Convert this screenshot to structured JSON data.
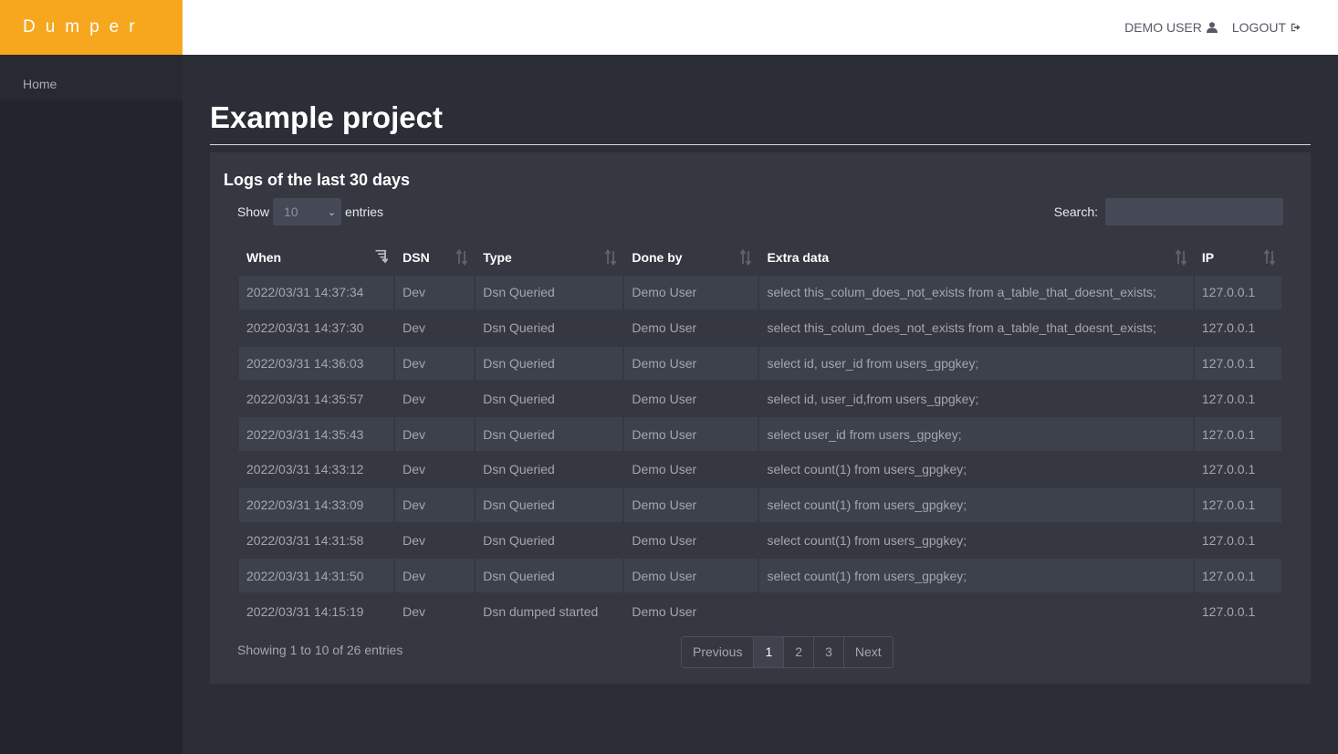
{
  "brand": "Dumper",
  "topnav": {
    "user": "DEMO USER",
    "logout": "LOGOUT"
  },
  "sidebar": {
    "items": [
      {
        "label": "Home"
      }
    ]
  },
  "page": {
    "title": "Example project"
  },
  "card": {
    "title": "Logs of the last 30 days",
    "length": {
      "show": "Show",
      "value": "10",
      "entries": "entries"
    },
    "search": {
      "label": "Search:",
      "value": ""
    },
    "columns": [
      "When",
      "DSN",
      "Type",
      "Done by",
      "Extra data",
      "IP"
    ],
    "rows": [
      [
        "2022/03/31 14:37:34",
        "Dev",
        "Dsn Queried",
        "Demo User",
        "select this_colum_does_not_exists from a_table_that_doesnt_exists;",
        "127.0.0.1"
      ],
      [
        "2022/03/31 14:37:30",
        "Dev",
        "Dsn Queried",
        "Demo User",
        "select this_colum_does_not_exists from a_table_that_doesnt_exists;",
        "127.0.0.1"
      ],
      [
        "2022/03/31 14:36:03",
        "Dev",
        "Dsn Queried",
        "Demo User",
        "select id, user_id from users_gpgkey;",
        "127.0.0.1"
      ],
      [
        "2022/03/31 14:35:57",
        "Dev",
        "Dsn Queried",
        "Demo User",
        "select id, user_id,from users_gpgkey;",
        "127.0.0.1"
      ],
      [
        "2022/03/31 14:35:43",
        "Dev",
        "Dsn Queried",
        "Demo User",
        "select user_id from users_gpgkey;",
        "127.0.0.1"
      ],
      [
        "2022/03/31 14:33:12",
        "Dev",
        "Dsn Queried",
        "Demo User",
        "select count(1) from users_gpgkey;",
        "127.0.0.1"
      ],
      [
        "2022/03/31 14:33:09",
        "Dev",
        "Dsn Queried",
        "Demo User",
        "select count(1) from users_gpgkey;",
        "127.0.0.1"
      ],
      [
        "2022/03/31 14:31:58",
        "Dev",
        "Dsn Queried",
        "Demo User",
        "select count(1) from users_gpgkey;",
        "127.0.0.1"
      ],
      [
        "2022/03/31 14:31:50",
        "Dev",
        "Dsn Queried",
        "Demo User",
        "select count(1) from users_gpgkey;",
        "127.0.0.1"
      ],
      [
        "2022/03/31 14:15:19",
        "Dev",
        "Dsn dumped started",
        "Demo User",
        "",
        "127.0.0.1"
      ]
    ],
    "info": "Showing 1 to 10 of 26 entries",
    "pagination": {
      "previous": "Previous",
      "pages": [
        "1",
        "2",
        "3"
      ],
      "active": "1",
      "next": "Next"
    }
  },
  "colors": {
    "brand": "#f6a71e",
    "background": "#2b2e36",
    "sidebar": "#23252d",
    "card": "#353841"
  }
}
